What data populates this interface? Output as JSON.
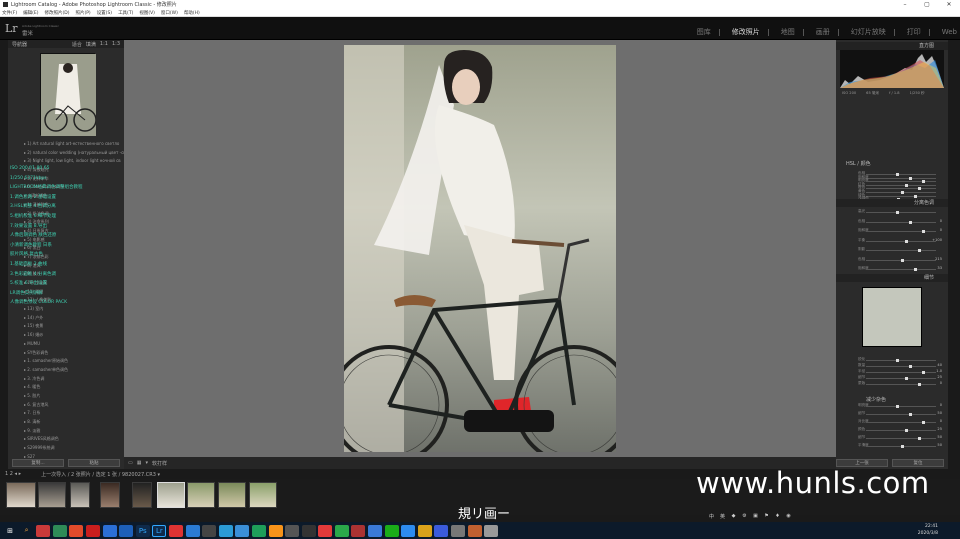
{
  "window": {
    "title": "Lightroom Catalog - Adobe Photoshop Lightroom Classic - 修改照片"
  },
  "menu": [
    "文件(F)",
    "编辑(E)",
    "修改照片(D)",
    "照片(P)",
    "设置(S)",
    "工具(T)",
    "视图(V)",
    "窗口(W)",
    "帮助(H)"
  ],
  "identity": {
    "logo": "Lr",
    "subtitle": "Adobe Lightroom Classic",
    "name": "雷米"
  },
  "modules": [
    {
      "label": "图库",
      "active": false
    },
    {
      "label": "修改照片",
      "active": true
    },
    {
      "label": "地图",
      "active": false
    },
    {
      "label": "画册",
      "active": false
    },
    {
      "label": "幻灯片放映",
      "active": false
    },
    {
      "label": "打印",
      "active": false
    },
    {
      "label": "Web",
      "active": false
    }
  ],
  "left": {
    "navigator": {
      "title": "导航器",
      "options": [
        "适合",
        "填满",
        "1:1",
        "1:3"
      ]
    },
    "presets": [
      "1) Art natural light art-естественного светло",
      "2) natural color wedding (натуральный цвет -св",
      "3) Night light, low light, indoor light ночной св",
      "4) 深夜暗光",
      "5) 花样年华",
      "6) Camera natural",
      "小清新调色",
      "1) 清新肤色",
      "2) 奶油色调",
      "3) 治愈系列",
      "4) 日系复古",
      "5) 电影感",
      "6) 黑白",
      "7) 浓郁色彩",
      "8) 港风",
      "9) 胶片",
      "10) 冷淡风",
      "11) 暖阳",
      "12) 人像美肤",
      "13) 室内",
      "14) 户外",
      "15) 夜景",
      "16) 婚纱",
      "MUMU",
      "SY色彩调色",
      "1. samasher原始调色",
      "2. samasher单色调色",
      "3. 冷色调",
      "4. 暖色",
      "5. 胶片",
      "6. 复古港风",
      "7. 日系",
      "8. 清新",
      "9. 淡雅",
      "SIRIVES风格调色",
      "S29999系统调",
      "S27",
      "S29196",
      "S30",
      "S29",
      "S30",
      "S31",
      "S32"
    ],
    "overlay": [
      "ISO 200   f/1.80   65",
      "          1/250   6371kbps",
      "LIGHTROOM经典调色调整组合教程",
      "1.调色思路   2.基础设置",
      "3.HSL调整   4.色调分离",
      "5.相机校准   6.细节处理",
      "7.效果设置   8.导出",
      "人像后期调色   肤色还原",
      "小清新调色教程   日系",
      "胶片风格   复古色",
      "1.基础面板   2.曲线",
      "3.色彩面板   4.分离色调",
      "5.校准   6.导出设置",
      "LR调色实例讲解",
      "人像调色预设   COLOR PACK"
    ],
    "buttons": {
      "copy": "复制...",
      "paste": "粘贴"
    }
  },
  "toolbar": {
    "items": [
      "▭",
      "▦",
      "▾",
      "软打样"
    ]
  },
  "right": {
    "histogram": {
      "title": "直方图",
      "iso": "ISO 200",
      "focal": "65 毫米",
      "aperture": "f / 1.8",
      "shutter": "1/250 秒"
    },
    "hsl": {
      "title": "HSL / 颜色",
      "rows": [
        "色相",
        "饱和度",
        "明亮度",
        "红色",
        "橙色",
        "黄色",
        "绿色",
        "浅绿色",
        "蓝色"
      ]
    },
    "split": {
      "title": "分离色调",
      "labels": [
        "高光",
        "色相",
        "饱和度",
        "平衡",
        "阴影",
        "色相",
        "饱和度"
      ],
      "values": [
        "0",
        "0",
        "+100",
        "215",
        "33"
      ]
    },
    "detail": {
      "title": "细节"
    },
    "sharpen": {
      "labels": [
        "锐化",
        "数量",
        "半径",
        "细节",
        "蒙版"
      ],
      "values": [
        "40",
        "1.0",
        "25",
        "0"
      ]
    },
    "noise": {
      "title": "减少杂色",
      "labels": [
        "明亮度",
        "细节",
        "对比度",
        "颜色",
        "细节",
        "平滑度"
      ],
      "values": [
        "0",
        "50",
        "0",
        "25",
        "50",
        "50"
      ]
    },
    "buttons": {
      "prev": "上一张",
      "reset": "复位"
    }
  },
  "filmbar": {
    "nav": "1 2 ◂ ▸",
    "source": "上一次导入 / 2 张照片 / 选定 1 张 / 9820027.CR3 ▾"
  },
  "caption": "規リ画ー",
  "watermark": "www.hunls.com",
  "tray": [
    "中",
    "英",
    "◆",
    "⚙",
    "▣",
    "⚑",
    "♦",
    "◉"
  ],
  "clock": {
    "time": "22:41",
    "date": "2020/3/8"
  }
}
